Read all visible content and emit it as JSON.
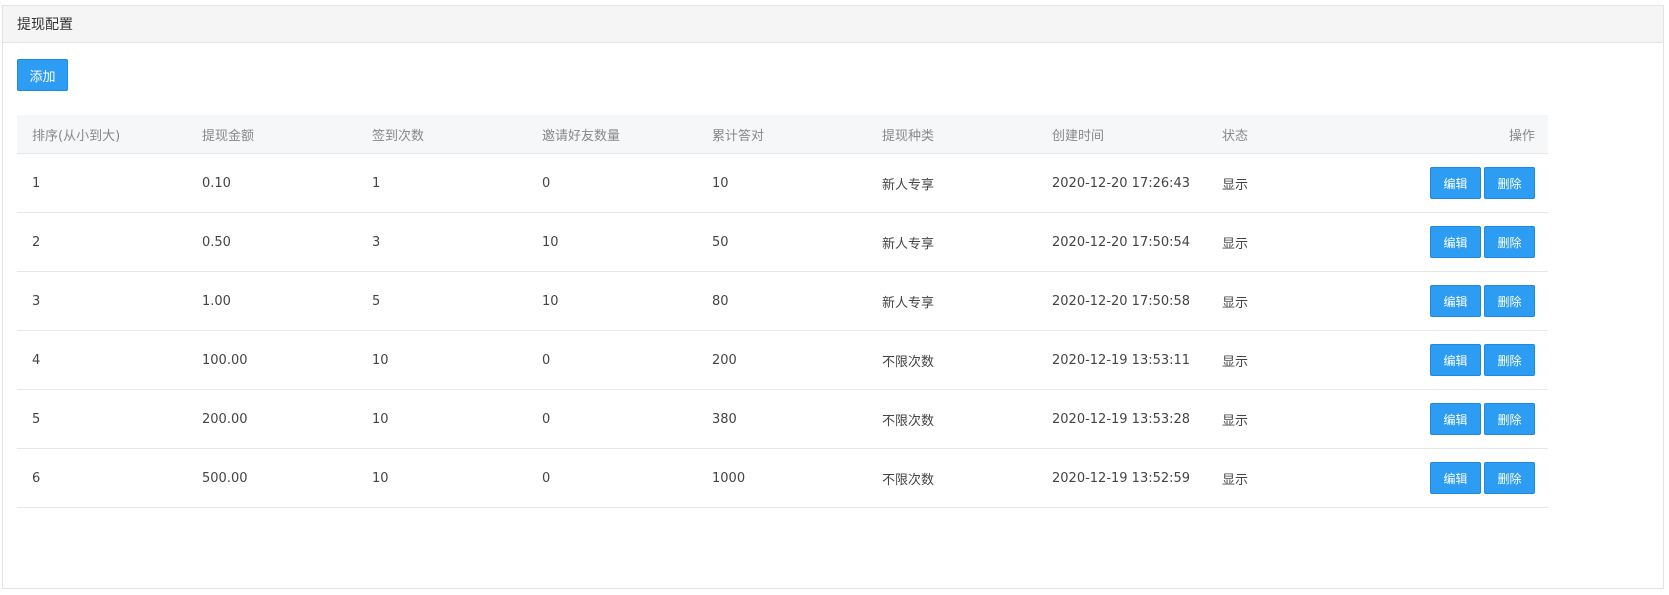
{
  "panel": {
    "title": "提现配置"
  },
  "toolbar": {
    "add_label": "添加"
  },
  "table": {
    "headers": [
      "排序(从小到大)",
      "提现金额",
      "签到次数",
      "邀请好友数量",
      "累计答对",
      "提现种类",
      "创建时间",
      "状态",
      "操作"
    ],
    "rows": [
      {
        "cells": [
          "1",
          "0.10",
          "1",
          "0",
          "10",
          "新人专享",
          "2020-12-20 17:26:43",
          "显示"
        ],
        "edit": "编辑",
        "delete": "删除"
      },
      {
        "cells": [
          "2",
          "0.50",
          "3",
          "10",
          "50",
          "新人专享",
          "2020-12-20 17:50:54",
          "显示"
        ],
        "edit": "编辑",
        "delete": "删除"
      },
      {
        "cells": [
          "3",
          "1.00",
          "5",
          "10",
          "80",
          "新人专享",
          "2020-12-20 17:50:58",
          "显示"
        ],
        "edit": "编辑",
        "delete": "删除"
      },
      {
        "cells": [
          "4",
          "100.00",
          "10",
          "0",
          "200",
          "不限次数",
          "2020-12-19 13:53:11",
          "显示"
        ],
        "edit": "编辑",
        "delete": "删除"
      },
      {
        "cells": [
          "5",
          "200.00",
          "10",
          "0",
          "380",
          "不限次数",
          "2020-12-19 13:53:28",
          "显示"
        ],
        "edit": "编辑",
        "delete": "删除"
      },
      {
        "cells": [
          "6",
          "500.00",
          "10",
          "0",
          "1000",
          "不限次数",
          "2020-12-19 13:52:59",
          "显示"
        ],
        "edit": "编辑",
        "delete": "删除"
      }
    ]
  },
  "colors": {
    "primary": "#2d9cf3",
    "header_bg": "#f5f5f5",
    "thead_bg": "#f6f7f9"
  }
}
